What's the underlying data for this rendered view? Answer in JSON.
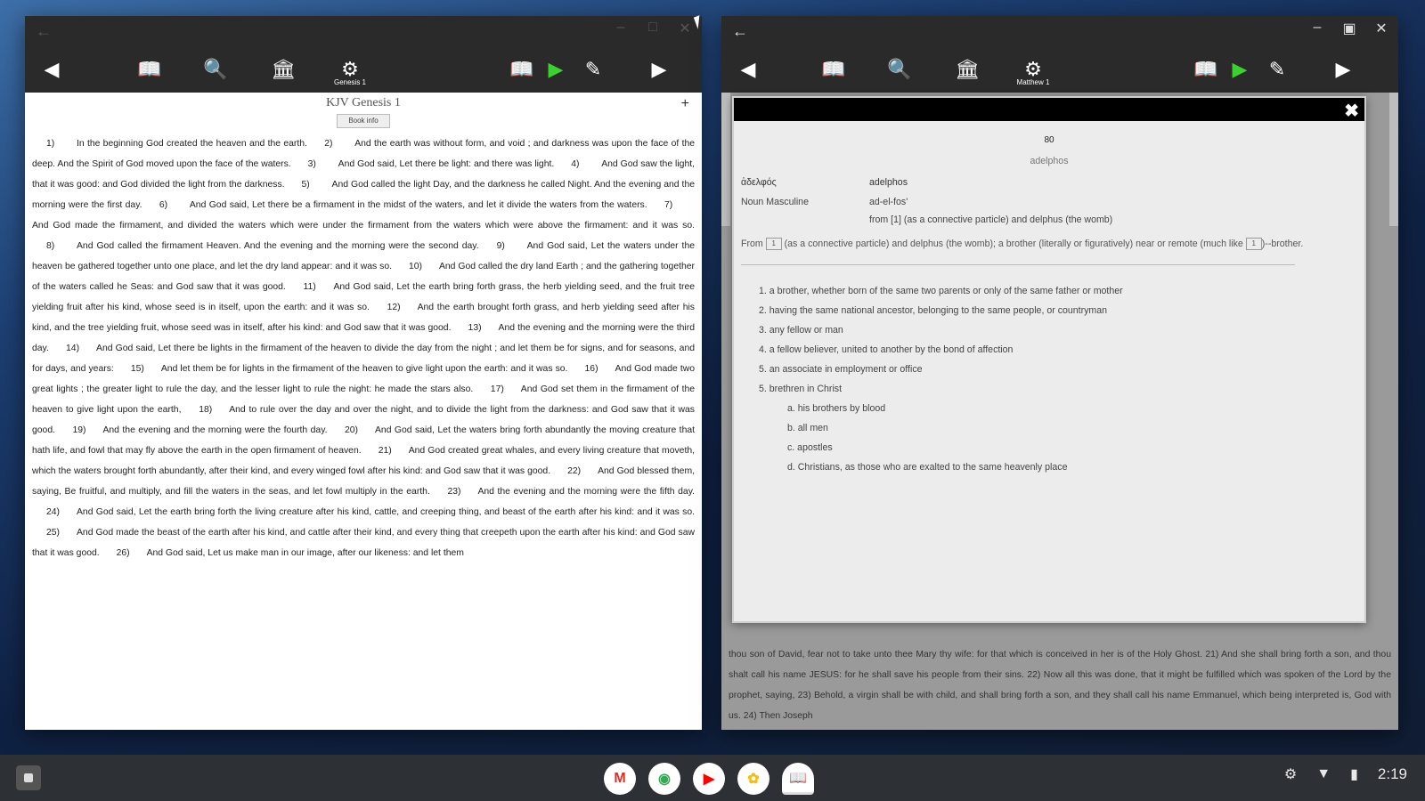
{
  "left_window": {
    "title_back": "←",
    "controls": [
      "–",
      "□",
      "✕"
    ],
    "toolbar": {
      "prev": "◀",
      "books": "📖",
      "search": "🔍",
      "library": "🏛",
      "settings": "⚙",
      "settings_caption": "Genesis 1",
      "parallel": "📖",
      "play": "▶",
      "edit": "✎",
      "next": "▶"
    },
    "page_title": "KJV Genesis 1",
    "book_info_label": "Book info",
    "plus": "+",
    "verses": [
      {
        "n": "1)",
        "t": "In the beginning God created the heaven and the earth."
      },
      {
        "n": "2)",
        "t": "And the earth was without form, and void ; and darkness was upon the face of the deep. And the Spirit of God moved upon the face of the waters."
      },
      {
        "n": "3)",
        "t": "And God said, Let there be light: and there was light."
      },
      {
        "n": "4)",
        "t": "And God saw the light, that it was good: and God divided the light from the darkness."
      },
      {
        "n": "5)",
        "t": "And God called the light Day, and the darkness he called Night. And the evening and the morning were the first day."
      },
      {
        "n": "6)",
        "t": "And God said, Let there be a firmament in the midst of the waters, and let it divide the waters from the waters."
      },
      {
        "n": "7)",
        "t": "And God made the firmament, and divided the waters which were under the firmament from the waters which were above the firmament: and it was so."
      },
      {
        "n": "8)",
        "t": "And God called the firmament Heaven. And the evening and the morning were the second day."
      },
      {
        "n": "9)",
        "t": "And God said, Let the waters under the heaven be gathered together unto one place, and let the dry land appear: and it was so."
      },
      {
        "n": "10)",
        "t": "And God called the dry land Earth ; and the gathering together of the waters called he Seas: and God saw that it was good."
      },
      {
        "n": "11)",
        "t": "And God said, Let the earth bring forth grass, the herb yielding seed, and the fruit tree yielding fruit after his kind, whose seed is in itself, upon the earth: and it was so."
      },
      {
        "n": "12)",
        "t": "And the earth brought forth grass, and herb yielding seed after his kind, and the tree yielding fruit, whose seed was in itself, after his kind: and God saw that it was good."
      },
      {
        "n": "13)",
        "t": "And the evening and the morning were the third day."
      },
      {
        "n": "14)",
        "t": "And God said, Let there be lights in the firmament of the heaven to divide the day from the night ; and let them be for signs, and for seasons, and for days, and years:"
      },
      {
        "n": "15)",
        "t": "And let them be for lights in the firmament of the heaven to give light upon the earth: and it was so."
      },
      {
        "n": "16)",
        "t": "And God made two great lights ; the greater light to rule the day, and the lesser light to rule the night: he made the stars also."
      },
      {
        "n": "17)",
        "t": "And God set them in the firmament of the heaven to give light upon the earth,"
      },
      {
        "n": "18)",
        "t": "And to rule over the day and over the night, and to divide the light from the darkness: and God saw that it was good."
      },
      {
        "n": "19)",
        "t": "And the evening and the morning were the fourth day."
      },
      {
        "n": "20)",
        "t": "And God said, Let the waters bring forth abundantly the moving creature that hath life, and fowl that may fly above the earth in the open firmament of heaven."
      },
      {
        "n": "21)",
        "t": "And God created great whales, and every living creature that moveth, which the waters brought forth abundantly, after their kind, and every winged fowl after his kind: and God saw that it was good."
      },
      {
        "n": "22)",
        "t": "And God blessed them, saying, Be fruitful, and multiply, and fill the waters in the seas, and let fowl multiply in the earth."
      },
      {
        "n": "23)",
        "t": "And the evening and the morning were the fifth day."
      },
      {
        "n": "24)",
        "t": "And God said, Let the earth bring forth the living creature after his kind, cattle, and creeping thing, and beast of the earth after his kind: and it was so."
      },
      {
        "n": "25)",
        "t": "And God made the beast of the earth after his kind, and cattle after their kind, and every thing that creepeth upon the earth after his kind: and God saw that it was good."
      },
      {
        "n": "26)",
        "t": "And God said, Let us make man in our image, after our likeness: and let them"
      }
    ]
  },
  "right_window": {
    "title_back": "←",
    "controls": [
      "–",
      "▣",
      "✕"
    ],
    "toolbar": {
      "prev": "◀",
      "books": "📖",
      "search": "🔍",
      "library": "🏛",
      "settings": "⚙",
      "settings_caption": "Matthew 1",
      "parallel": "📖",
      "play": "▶",
      "edit": "✎",
      "next": "▶"
    },
    "dialog": {
      "close": "✖",
      "strongs_number": "80",
      "transliteration": "adelphos",
      "greek": "ἀδελφός",
      "greek_translit": "adelphos",
      "part_of_speech": "Noun Masculine",
      "pronunciation": "ad-el-fos'",
      "derivation": "from [1] (as a connective particle) and delphus (the womb)",
      "from_prefix": "From",
      "from_box1": "1",
      "from_mid": "(as a connective particle) and delphus (the womb); a brother (literally or figuratively) near or remote (much like",
      "from_box2": "1",
      "from_suffix": ")--brother.",
      "definitions": [
        "1. a brother, whether born of the same two parents or only of the same father or mother",
        "2. having the same national ancestor, belonging to the same people, or countryman",
        "3. any fellow or man",
        "4. a fellow believer, united to another by the bond of affection",
        "5. an associate in employment or office",
        "5. brethren in Christ"
      ],
      "sub_definitions": [
        "a. his brothers by blood",
        "b. all men",
        "c. apostles",
        "d. Christians, as those who are exalted to the same heavenly place"
      ]
    },
    "bottom_text": "thou son of David, fear not to take unto thee Mary thy wife: for that which is conceived in her is of the Holy Ghost.  21)  And she shall bring forth a son, and thou shalt call his name JESUS: for he shall save his people from their sins.  22)  Now all this was done, that it might be fulfilled which was spoken of the Lord by the prophet, saying,  23)  Behold, a virgin shall be with child, and shall bring forth a son, and they shall call his name Emmanuel, which being interpreted is, God with us.  24)  Then Joseph"
  },
  "shelf": {
    "apps": [
      {
        "name": "gmail",
        "glyph": "M",
        "color": "#d93025"
      },
      {
        "name": "chrome",
        "glyph": "◉",
        "color": "#34a853"
      },
      {
        "name": "youtube",
        "glyph": "▶",
        "color": "#ff0000"
      },
      {
        "name": "photos",
        "glyph": "✿",
        "color": "#fbbc04"
      },
      {
        "name": "bible",
        "glyph": "📖",
        "color": "#1a73e8"
      }
    ],
    "tray": {
      "settings": "⚙",
      "wifi": "▼",
      "battery": "▮",
      "time": "2:19"
    }
  }
}
